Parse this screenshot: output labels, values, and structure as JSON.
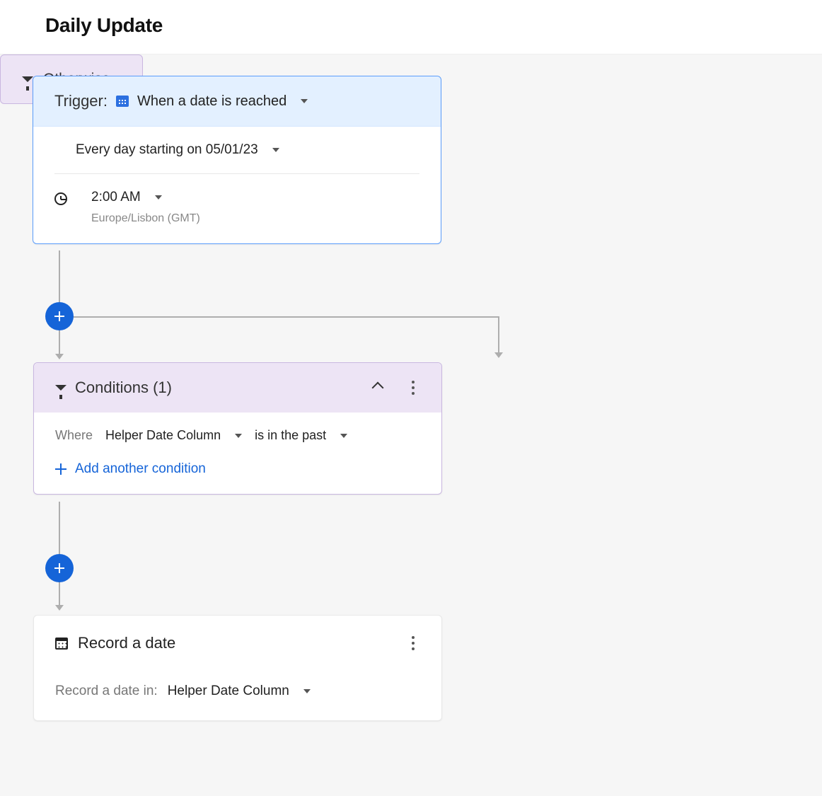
{
  "header": {
    "title": "Daily Update"
  },
  "trigger": {
    "label": "Trigger:",
    "type": "When a date is reached",
    "schedule_text": "Every day starting on 05/01/23",
    "time": "2:00 AM",
    "timezone": "Europe/Lisbon (GMT)"
  },
  "conditions": {
    "title": "Conditions (1)",
    "where_label": "Where",
    "field": "Helper Date Column",
    "operator": "is in the past",
    "add_label": "Add another condition"
  },
  "otherwise": {
    "label": "Otherwise"
  },
  "record": {
    "title": "Record a date",
    "in_label": "Record a date in:",
    "field": "Helper Date Column"
  }
}
